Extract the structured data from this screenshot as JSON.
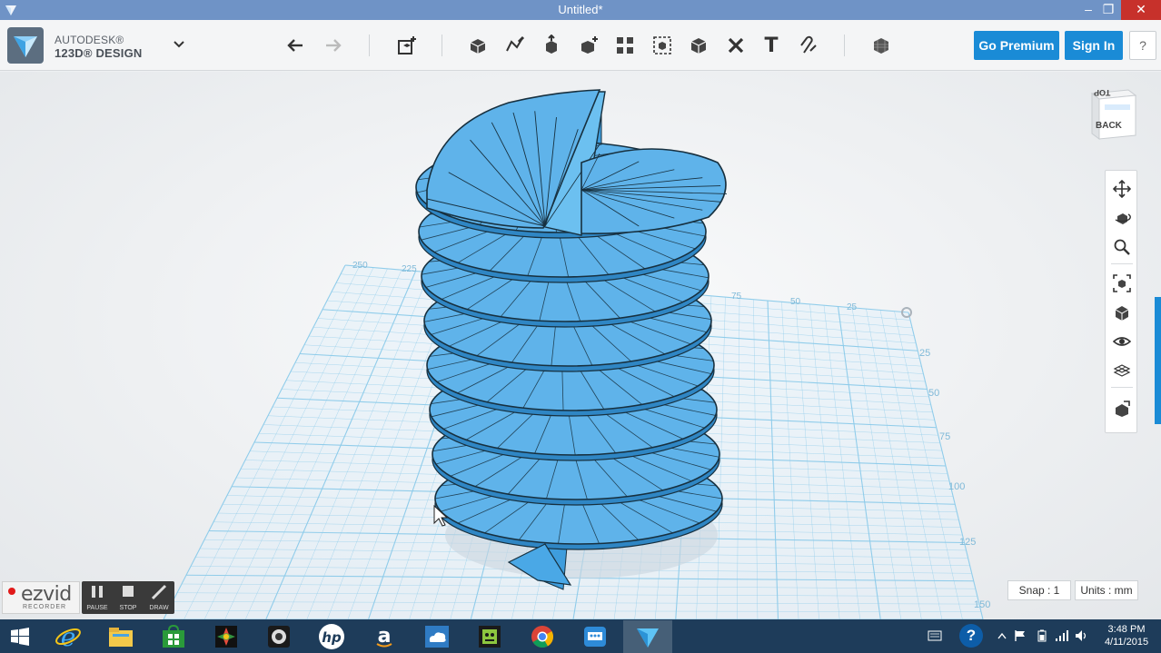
{
  "window": {
    "title": "Untitled*",
    "min_glyph": "–",
    "restore_glyph": "❐",
    "close_glyph": "✕"
  },
  "brand": {
    "line1": "AUTODESK®",
    "line2": "123D® DESIGN"
  },
  "toolbar": {
    "text_tool_glyph": "T",
    "go_premium_label": "Go Premium",
    "sign_in_label": "Sign In",
    "help_label": "?"
  },
  "viewcube": {
    "top_label": "TOP",
    "back_label": "BACK"
  },
  "grid": {
    "top_edge_labels": [
      "250",
      "225",
      "75",
      "50",
      "25"
    ],
    "right_edge_labels": [
      "25",
      "50",
      "75",
      "100",
      "125",
      "150"
    ]
  },
  "status": {
    "snap_label": "Snap : 1",
    "units_label": "Units : mm"
  },
  "ezvid": {
    "logo": "ezvid",
    "sub": "RECORDER",
    "pause_label": "PAUSE",
    "stop_label": "STOP",
    "draw_label": "DRAW"
  },
  "taskbar": {
    "time": "3:48 PM",
    "date": "4/11/2015",
    "help_glyph": "?"
  },
  "colors": {
    "accent": "#1a8bd6",
    "titlebar": "#6f93c6",
    "model_fill": "#5fb3ea",
    "grid_line": "#8ccbea",
    "taskbar": "#1e3c5a"
  }
}
